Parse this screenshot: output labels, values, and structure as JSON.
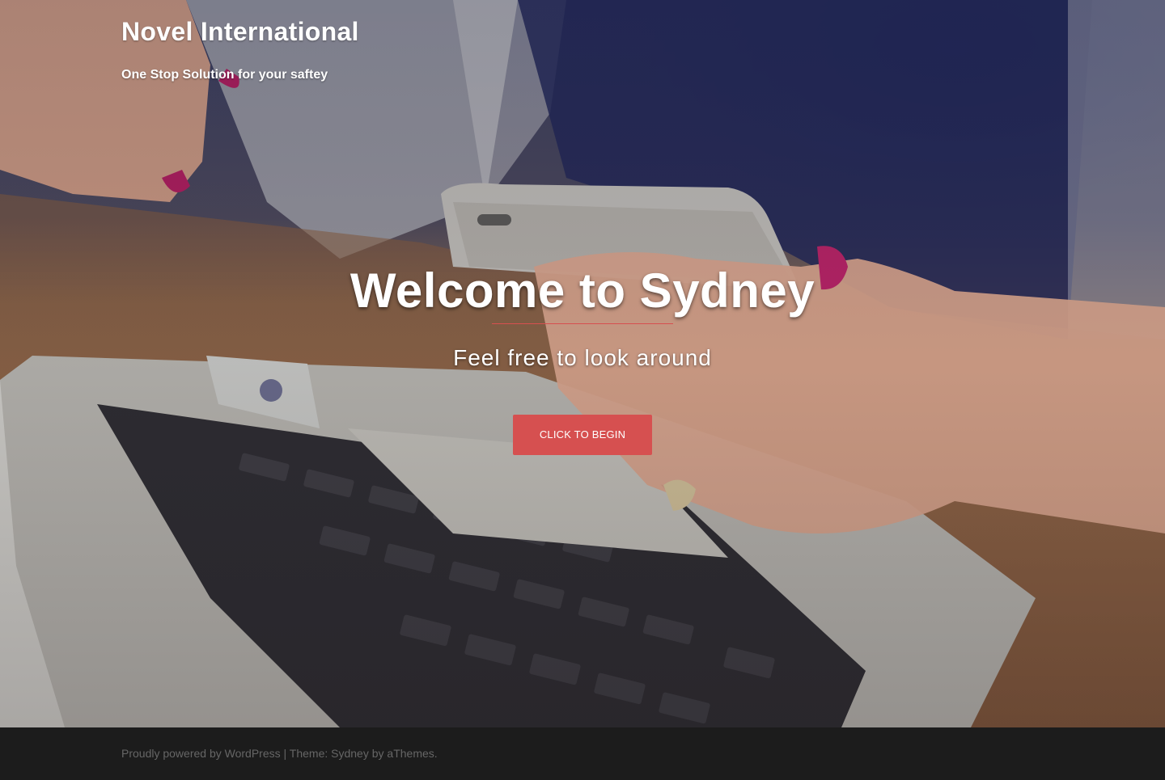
{
  "header": {
    "site_title": "Novel International",
    "site_description": "One Stop Solution for your saftey"
  },
  "hero": {
    "title": "Welcome to Sydney",
    "subtitle": "Feel free to look around",
    "button_label": "Click to begin",
    "accent_color": "#d65050"
  },
  "footer": {
    "powered_by": "Proudly powered by WordPress",
    "separator": "|",
    "theme_prefix": "Theme: Sydney by",
    "theme_author": "aThemes",
    "period": "."
  },
  "colors": {
    "footer_bg": "#1c1c1c",
    "footer_text": "#666666"
  }
}
